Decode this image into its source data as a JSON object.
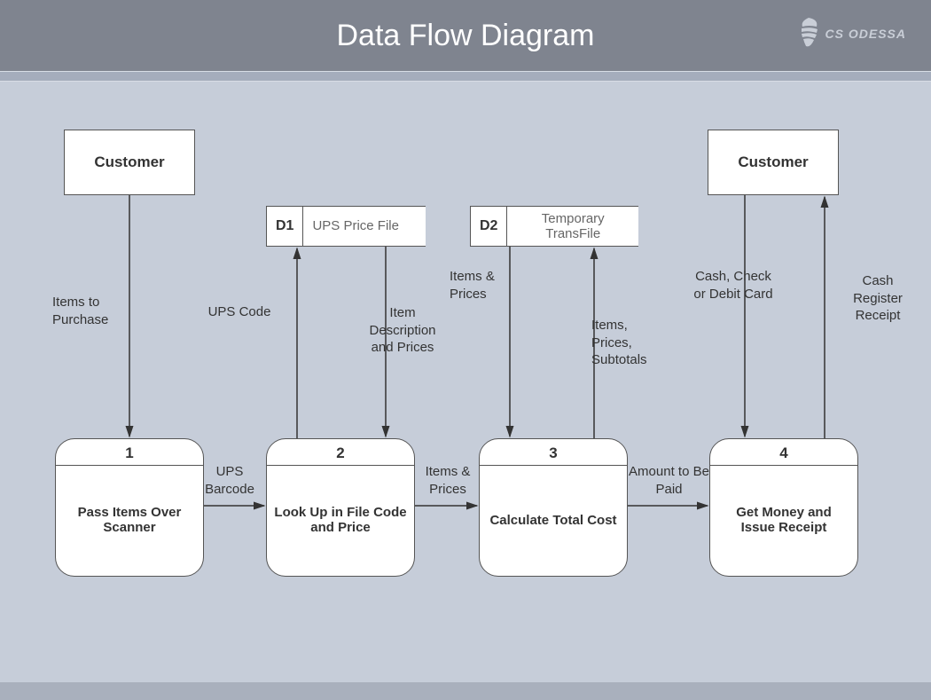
{
  "header": {
    "title": "Data Flow Diagram",
    "brand": "CS ODESSA"
  },
  "entities": {
    "customer_left": "Customer",
    "customer_right": "Customer"
  },
  "stores": {
    "d1": {
      "id": "D1",
      "label": "UPS Price File"
    },
    "d2": {
      "id": "D2",
      "label": "Temporary TransFile"
    }
  },
  "processes": {
    "p1": {
      "num": "1",
      "label": "Pass Items Over Scanner"
    },
    "p2": {
      "num": "2",
      "label": "Look Up in File Code and Price"
    },
    "p3": {
      "num": "3",
      "label": "Calculate Total Cost"
    },
    "p4": {
      "num": "4",
      "label": "Get Money and Issue Receipt"
    }
  },
  "flows": {
    "items_to_purchase": "Items to Purchase",
    "ups_code": "UPS Code",
    "item_desc_prices": "Item Description and Prices",
    "items_prices_1": "Items & Prices",
    "items_prices_subtotals": "Items, Prices, Subtotals",
    "cash_check_debit": "Cash, Check or Debit Card",
    "cash_register_receipt": "Cash Register Receipt",
    "ups_barcode": "UPS Barcode",
    "items_prices_2": "Items & Prices",
    "amount_to_be_paid": "Amount to Be Paid"
  }
}
